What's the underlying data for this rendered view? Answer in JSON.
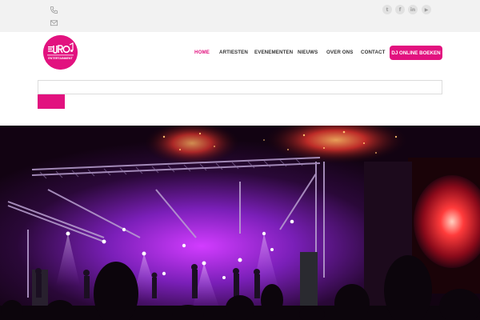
{
  "topbar": {
    "contact_icons": [
      "phone-icon",
      "envelope-icon"
    ],
    "social_icons": [
      {
        "name": "twitter-icon",
        "glyph": "t"
      },
      {
        "name": "facebook-icon",
        "glyph": "f"
      },
      {
        "name": "linkedin-icon",
        "glyph": "in"
      },
      {
        "name": "youtube-icon",
        "glyph": "▶"
      }
    ]
  },
  "logo": {
    "line1": "EURO",
    "line2": "ENTERTAINMENT",
    "color": "#e2127f"
  },
  "nav": {
    "items": [
      {
        "label": "HOME",
        "active": true
      },
      {
        "label": "ARTIESTEN",
        "active": false
      },
      {
        "label": "EVENEMENTEN",
        "active": false
      },
      {
        "label": "NIEUWS",
        "active": false
      },
      {
        "label": "OVER ONS",
        "active": false
      },
      {
        "label": "CONTACT",
        "active": false
      }
    ],
    "cta_label": "DJ ONLINE BOEKEN"
  },
  "search": {
    "value": "",
    "placeholder": ""
  },
  "hero": {
    "image": "concert-stage-photo"
  },
  "colors": {
    "accent": "#e2127f",
    "topbar_bg": "#f2f2f2",
    "nav_text": "#333333"
  }
}
